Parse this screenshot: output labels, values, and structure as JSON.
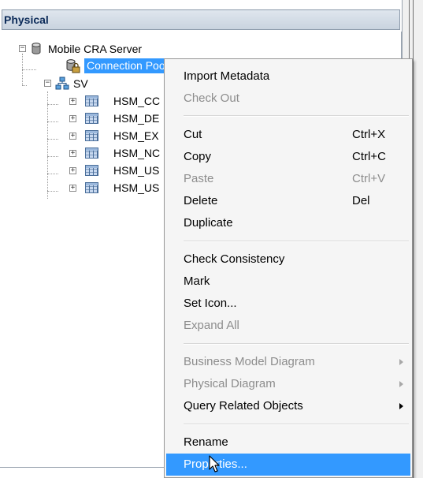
{
  "panel": {
    "title": "Physical"
  },
  "tree": {
    "root": {
      "label": "Mobile CRA Server",
      "icon": "database-icon"
    },
    "connection_pool": {
      "label": "Connection Pool",
      "icon": "connection-pool-icon"
    },
    "schema": {
      "label": "SV",
      "icon": "schema-icon"
    },
    "tables": [
      {
        "label": "HSM_CC"
      },
      {
        "label": "HSM_DE"
      },
      {
        "label": "HSM_EX"
      },
      {
        "label": "HSM_NC"
      },
      {
        "label": "HSM_US"
      },
      {
        "label": "HSM_US"
      }
    ]
  },
  "context_menu": {
    "items": [
      {
        "label": "Import Metadata",
        "shortcut": "",
        "disabled": false
      },
      {
        "label": "Check Out",
        "shortcut": "",
        "disabled": true
      },
      {
        "label": "Cut",
        "shortcut": "Ctrl+X",
        "disabled": false
      },
      {
        "label": "Copy",
        "shortcut": "Ctrl+C",
        "disabled": false
      },
      {
        "label": "Paste",
        "shortcut": "Ctrl+V",
        "disabled": true
      },
      {
        "label": "Delete",
        "shortcut": "Del",
        "disabled": false
      },
      {
        "label": "Duplicate",
        "shortcut": "",
        "disabled": false
      },
      {
        "label": "Check Consistency",
        "shortcut": "",
        "disabled": false
      },
      {
        "label": "Mark",
        "shortcut": "",
        "disabled": false
      },
      {
        "label": "Set Icon...",
        "shortcut": "",
        "disabled": false
      },
      {
        "label": "Expand All",
        "shortcut": "",
        "disabled": true
      },
      {
        "label": "Business Model Diagram",
        "shortcut": "",
        "disabled": true,
        "submenu": true
      },
      {
        "label": "Physical Diagram",
        "shortcut": "",
        "disabled": true,
        "submenu": true
      },
      {
        "label": "Query Related Objects",
        "shortcut": "",
        "disabled": false,
        "submenu": true
      },
      {
        "label": "Rename",
        "shortcut": "",
        "disabled": false
      },
      {
        "label": "Properties...",
        "shortcut": "",
        "disabled": false,
        "highlighted": true
      }
    ]
  },
  "colors": {
    "selection": "#3399ff",
    "menu_bg": "#f5f5f5",
    "disabled_text": "#8d8d8d"
  }
}
